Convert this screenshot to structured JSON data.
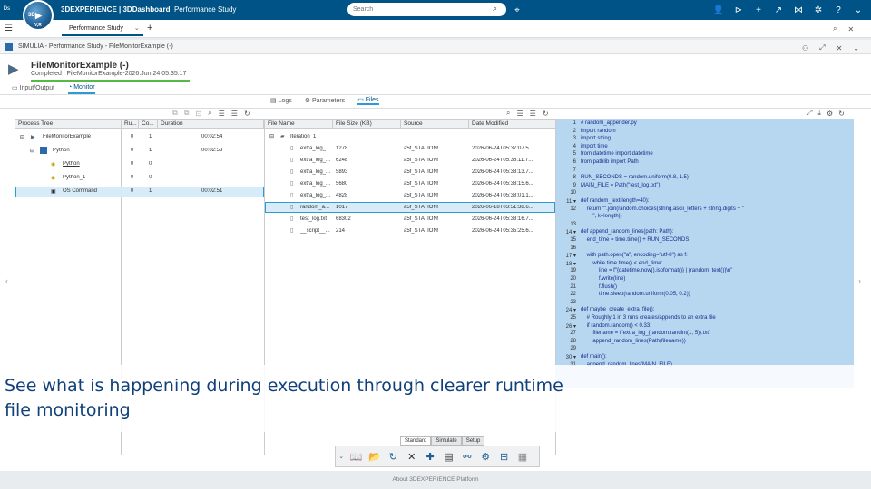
{
  "topbar": {
    "brand_strong": "3DEXPERIENCE | 3DDashboard",
    "brand_app": "Performance Study",
    "compass_left": "3D",
    "compass_right": "V,R",
    "search_placeholder": "Search",
    "icons": [
      "tag-icon",
      "user-icon",
      "share-icon",
      "add-icon",
      "forward-icon",
      "network-icon",
      "tools-icon",
      "help-icon",
      "chevron-down-icon"
    ]
  },
  "tabbar": {
    "dashboard_tab": "Performance Study"
  },
  "appbar": {
    "title": "SIMULIA - Performance Study - FileMonitorExample (-)"
  },
  "header": {
    "title": "FileMonitorExample (-)",
    "status": "Completed | FileMonitorExample-2026.Jun.24 05:35:17",
    "progress": 1.0
  },
  "subtabs": {
    "input_output": "Input/Output",
    "monitor": "Monitor"
  },
  "filetabs": {
    "logs": "Logs",
    "parameters": "Parameters",
    "files": "Files"
  },
  "process_tree": {
    "headers": [
      "Process Tree",
      "Ru...",
      "Co...",
      "Duration"
    ],
    "rows": [
      {
        "name": "FileMonitorExample",
        "ru": "0",
        "co": "1",
        "duration": "00:02:54"
      },
      {
        "name": "Python",
        "ru": "0",
        "co": "1",
        "duration": "00:02:53"
      },
      {
        "name": "Python",
        "ru": "0",
        "co": "0",
        "duration": ""
      },
      {
        "name": "Python_1",
        "ru": "0",
        "co": "0",
        "duration": ""
      },
      {
        "name": "OS Command",
        "ru": "0",
        "co": "1",
        "duration": "00:02:51"
      }
    ]
  },
  "files": {
    "headers": [
      "File Name",
      "File Size (KB)",
      "Source",
      "Date Modified"
    ],
    "rows": [
      {
        "name": "Iteration_1",
        "size": "",
        "source": "",
        "date": ""
      },
      {
        "name": "extra_log_...",
        "size": "1278",
        "source": "a5f_STATION!",
        "date": "2026-06-24T05:37:07.5..."
      },
      {
        "name": "extra_log_...",
        "size": "6248",
        "source": "a5f_STATION!",
        "date": "2026-06-24T05:38:11.7..."
      },
      {
        "name": "extra_log_...",
        "size": "5893",
        "source": "a5f_STATION!",
        "date": "2026-06-24T05:38:13.7..."
      },
      {
        "name": "extra_log_...",
        "size": "5680",
        "source": "a5f_STATION!",
        "date": "2026-06-24T05:38:15.6..."
      },
      {
        "name": "extra_log_...",
        "size": "4828",
        "source": "a5f_STATION!",
        "date": "2026-06-24T05:38:01.1..."
      },
      {
        "name": "random_a...",
        "size": "1017",
        "source": "a5f_STATION!",
        "date": "2026-06-18T03:51:38.6..."
      },
      {
        "name": "test_log.txt",
        "size": "68302",
        "source": "a5f_STATION!",
        "date": "2026-06-24T05:38:16.7..."
      },
      {
        "name": "__script__...",
        "size": "214",
        "source": "a5f_STATION!",
        "date": "2026-06-24T05:35:25.6..."
      }
    ]
  },
  "code": {
    "lines": [
      {
        "n": "1",
        "t": "# random_appender.py"
      },
      {
        "n": "2",
        "t": "import random"
      },
      {
        "n": "3",
        "t": "import string"
      },
      {
        "n": "4",
        "t": "import time"
      },
      {
        "n": "5",
        "t": "from datetime import datetime"
      },
      {
        "n": "6",
        "t": "from pathlib import Path"
      },
      {
        "n": "7",
        "t": ""
      },
      {
        "n": "8",
        "t": "RUN_SECONDS = random.uniform(0.8, 1.5)"
      },
      {
        "n": "9",
        "t": "MAIN_FILE = Path(\"test_log.txt\")"
      },
      {
        "n": "10",
        "t": ""
      },
      {
        "n": "11 ▾",
        "t": "def random_text(length=40):"
      },
      {
        "n": "12",
        "t": "    return \"\".join(random.choices(string.ascii_letters + string.digits + \""
      },
      {
        "n": "",
        "t": "        \", k=length))"
      },
      {
        "n": "13",
        "t": ""
      },
      {
        "n": "14 ▾",
        "t": "def append_random_lines(path: Path):"
      },
      {
        "n": "15",
        "t": "    end_time = time.time() + RUN_SECONDS"
      },
      {
        "n": "16",
        "t": ""
      },
      {
        "n": "17 ▾",
        "t": "    with path.open(\"a\", encoding=\"utf-8\") as f:"
      },
      {
        "n": "18 ▾",
        "t": "        while time.time() < end_time:"
      },
      {
        "n": "19",
        "t": "            line = f\"{datetime.now().isoformat()} | {random_text()}\\n\""
      },
      {
        "n": "20",
        "t": "            f.write(line)"
      },
      {
        "n": "21",
        "t": "            f.flush()"
      },
      {
        "n": "22",
        "t": "            time.sleep(random.uniform(0.05, 0.2))"
      },
      {
        "n": "23",
        "t": ""
      },
      {
        "n": "24 ▾",
        "t": "def maybe_create_extra_file():"
      },
      {
        "n": "25",
        "t": "    # Roughly 1 in 3 runs creates/appends to an extra file"
      },
      {
        "n": "26 ▾",
        "t": "    if random.random() < 0.33:"
      },
      {
        "n": "27",
        "t": "        filename = f\"extra_log_{random.randint(1, 5)}.txt\""
      },
      {
        "n": "28",
        "t": "        append_random_lines(Path(filename))"
      },
      {
        "n": "29",
        "t": ""
      },
      {
        "n": "30 ▾",
        "t": "def main():"
      },
      {
        "n": "31",
        "t": "    append_random_lines(MAIN_FILE)"
      }
    ]
  },
  "banner": {
    "text": "See what is happening during execution through clearer runtime file monitoring"
  },
  "bottom_tabs": [
    "Standard",
    "Simulate",
    "Setup"
  ],
  "footer": {
    "text": "About 3DEXPERIENCE Platform"
  }
}
